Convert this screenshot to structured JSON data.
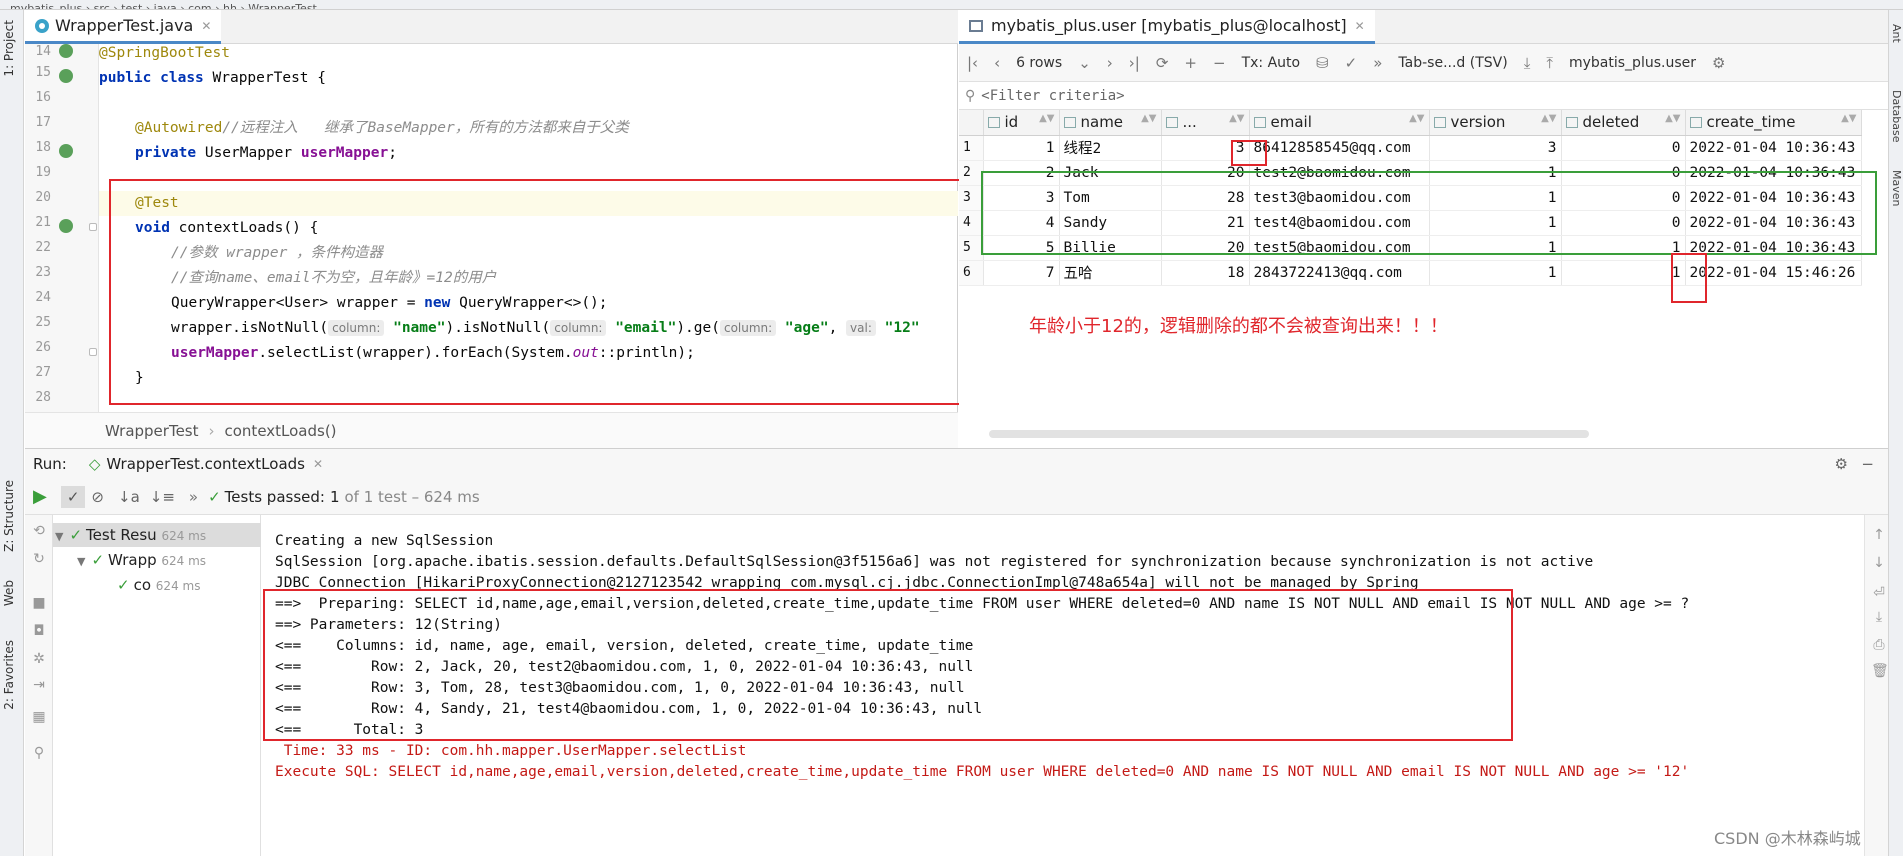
{
  "topstrip": {
    "text": "mybatis_plus  ›  src  ›  test  ›  java  ›  com  ›  hh  ›  WrapperTest"
  },
  "left_tabs": {
    "project": "1: Project",
    "structure": "Z: Structure",
    "web": "Web",
    "favorites": "2: Favorites"
  },
  "right_tabs": {
    "ant": "Ant",
    "database": "Database",
    "maven": "Maven"
  },
  "editor": {
    "tab_label": "WrapperTest.java",
    "line_numbers": [
      "14",
      "15",
      "16",
      "17",
      "18",
      "19",
      "20",
      "21",
      "22",
      "23",
      "24",
      "25",
      "26",
      "27",
      "28"
    ],
    "lines": {
      "l14": "@SpringBootTest",
      "l15_kw1": "public",
      "l15_kw2": "class",
      "l15_rest": " WrapperTest {",
      "l17_ann": "@Autowired",
      "l17_cm": "//远程注入   继承了BaseMapper，所有的方法都来自于父类",
      "l18_kw": "private",
      "l18_type": " UserMapper ",
      "l18_fld": "userMapper",
      "l18_end": ";",
      "l20_ann": "@Test",
      "l21_kw": "void",
      "l21_rest": " contextLoads() {",
      "l22_cm": "//参数 wrapper ，条件构造器",
      "l23_cm": "//查询name、email不为空，且年龄》=12的用户",
      "l24_a": "QueryWrapper<User> wrapper = ",
      "l24_kw": "new",
      "l24_b": " QueryWrapper<>();",
      "l25_a": "wrapper.isNotNull(",
      "l25_h1": "column:",
      "l25_s1": "\"name\"",
      "l25_b": ").isNotNull(",
      "l25_h2": "column:",
      "l25_s2": "\"email\"",
      "l25_c": ").ge(",
      "l25_h3": "column:",
      "l25_s3": "\"age\"",
      "l25_d": ", ",
      "l25_h4": "val:",
      "l25_s4": "\"12\"",
      "l26_fld": "userMapper",
      "l26_a": ".selectList(wrapper).forEach(System.",
      "l26_out": "out",
      "l26_b": "::println);",
      "l27": "}"
    },
    "breadcrumb": [
      "WrapperTest",
      "contextLoads()"
    ]
  },
  "db": {
    "tab_label": "mybatis_plus.user [mybatis_plus@localhost]",
    "toolbar": {
      "rows": "6 rows",
      "tx": "Tx: Auto",
      "format": "Tab-se...d (TSV)",
      "datasource": "mybatis_plus.user"
    },
    "filter_placeholder": "<Filter criteria>",
    "columns": [
      "id",
      "name",
      "...",
      "email",
      "version",
      "deleted",
      "create_time"
    ],
    "rows": [
      {
        "rn": "1",
        "id": "1",
        "name": "线程2",
        "age": "3",
        "email": "86412858545@qq.com",
        "version": "3",
        "deleted": "0",
        "create_time": "2022-01-04 10:36:43"
      },
      {
        "rn": "2",
        "id": "2",
        "name": "Jack",
        "age": "20",
        "email": "test2@baomidou.com",
        "version": "1",
        "deleted": "0",
        "create_time": "2022-01-04 10:36:43"
      },
      {
        "rn": "3",
        "id": "3",
        "name": "Tom",
        "age": "28",
        "email": "test3@baomidou.com",
        "version": "1",
        "deleted": "0",
        "create_time": "2022-01-04 10:36:43"
      },
      {
        "rn": "4",
        "id": "4",
        "name": "Sandy",
        "age": "21",
        "email": "test4@baomidou.com",
        "version": "1",
        "deleted": "0",
        "create_time": "2022-01-04 10:36:43"
      },
      {
        "rn": "5",
        "id": "5",
        "name": "Billie",
        "age": "20",
        "email": "test5@baomidou.com",
        "version": "1",
        "deleted": "1",
        "create_time": "2022-01-04 10:36:43"
      },
      {
        "rn": "6",
        "id": "7",
        "name": "五哈",
        "age": "18",
        "email": "2843722413@qq.com",
        "version": "1",
        "deleted": "1",
        "create_time": "2022-01-04 15:46:26"
      }
    ],
    "note": "年龄小于12的，逻辑删除的都不会被查询出来！！！"
  },
  "run": {
    "label": "Run:",
    "config": "WrapperTest.contextLoads",
    "status_prefix": "Tests passed:",
    "status_count": "1",
    "status_suffix": "of 1 test – 624 ms",
    "tree": [
      {
        "label": "Test Resu",
        "time": "624 ms"
      },
      {
        "label": "Wrapp",
        "time": "624 ms"
      },
      {
        "label": "co",
        "time": "624 ms"
      }
    ],
    "console": [
      "Creating a new SqlSession",
      "SqlSession [org.apache.ibatis.session.defaults.DefaultSqlSession@3f5156a6] was not registered for synchronization because synchronization is not active",
      "JDBC Connection [HikariProxyConnection@2127123542 wrapping com.mysql.cj.jdbc.ConnectionImpl@748a654a] will not be managed by Spring",
      "==>  Preparing: SELECT id,name,age,email,version,deleted,create_time,update_time FROM user WHERE deleted=0 AND name IS NOT NULL AND email IS NOT NULL AND age >= ?",
      "==> Parameters: 12(String)",
      "<==    Columns: id, name, age, email, version, deleted, create_time, update_time",
      "<==        Row: 2, Jack, 20, test2@baomidou.com, 1, 0, 2022-01-04 10:36:43, null",
      "<==        Row: 3, Tom, 28, test3@baomidou.com, 1, 0, 2022-01-04 10:36:43, null",
      "<==        Row: 4, Sandy, 21, test4@baomidou.com, 1, 0, 2022-01-04 10:36:43, null",
      "<==      Total: 3",
      " Time: 33 ms - ID: com.hh.mapper.UserMapper.selectList",
      "Execute SQL: SELECT id,name,age,email,version,deleted,create_time,update_time FROM user WHERE deleted=0 AND name IS NOT NULL AND email IS NOT NULL AND age >= '12'"
    ]
  },
  "watermark": "CSDN @木林森屿城"
}
